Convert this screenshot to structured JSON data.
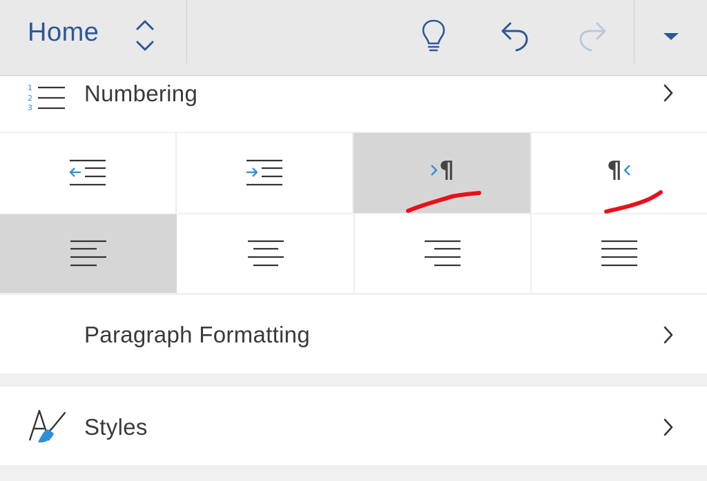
{
  "header": {
    "tab_title": "Home",
    "accent_color": "#2b579a",
    "icons": [
      "tab-switch-icon",
      "lightbulb-icon",
      "undo-icon",
      "redo-icon",
      "dropdown-icon"
    ]
  },
  "list": {
    "numbering_label": "Numbering",
    "numbering_digits": [
      "1",
      "2",
      "3"
    ],
    "paragraph_formatting_label": "Paragraph Formatting",
    "styles_label": "Styles"
  },
  "indent_row": {
    "buttons": [
      "decrease-indent",
      "increase-indent",
      "left-to-right-text",
      "right-to-left-text"
    ],
    "selected": "left-to-right-text",
    "pilcrow": "¶"
  },
  "align_row": {
    "buttons": [
      "align-left",
      "align-center",
      "align-right",
      "justify"
    ],
    "selected": "align-left"
  },
  "colors": {
    "accent_blue": "#2e8fd8",
    "annotation_red": "#e8101a",
    "selected_bg": "#d6d6d6"
  }
}
